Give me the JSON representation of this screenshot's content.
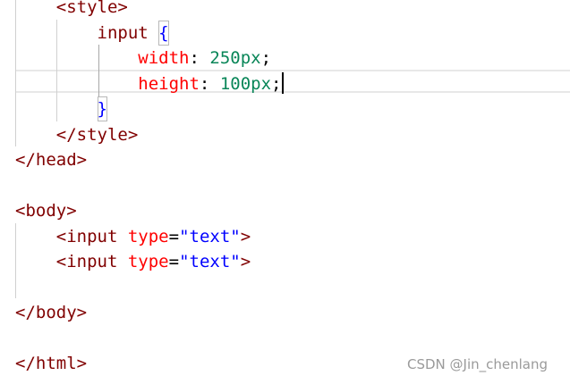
{
  "editor": {
    "lines": [
      {
        "indent": "    ",
        "parts": [
          {
            "t": "<style>",
            "c": "tag"
          }
        ]
      },
      {
        "indent": "        ",
        "parts": [
          {
            "t": "input",
            "c": "sel"
          },
          {
            "t": " ",
            "c": "punct"
          },
          {
            "t": "{",
            "c": "brace"
          }
        ]
      },
      {
        "indent": "            ",
        "parts": [
          {
            "t": "width",
            "c": "prop"
          },
          {
            "t": ": ",
            "c": "punct"
          },
          {
            "t": "250px",
            "c": "num"
          },
          {
            "t": ";",
            "c": "punct"
          }
        ]
      },
      {
        "indent": "            ",
        "parts": [
          {
            "t": "height",
            "c": "prop"
          },
          {
            "t": ": ",
            "c": "punct"
          },
          {
            "t": "100px",
            "c": "num"
          },
          {
            "t": ";",
            "c": "punct"
          }
        ]
      },
      {
        "indent": "        ",
        "parts": [
          {
            "t": "}",
            "c": "brace"
          }
        ]
      },
      {
        "indent": "    ",
        "parts": [
          {
            "t": "</style>",
            "c": "tag"
          }
        ]
      },
      {
        "indent": "",
        "parts": [
          {
            "t": "</head>",
            "c": "tag"
          }
        ]
      },
      {
        "indent": "",
        "parts": []
      },
      {
        "indent": "",
        "parts": [
          {
            "t": "<body>",
            "c": "tag"
          }
        ]
      },
      {
        "indent": "    ",
        "parts": [
          {
            "t": "<input",
            "c": "tag"
          },
          {
            "t": " ",
            "c": "punct"
          },
          {
            "t": "type",
            "c": "attr"
          },
          {
            "t": "=",
            "c": "punct"
          },
          {
            "t": "\"text\"",
            "c": "str"
          },
          {
            "t": ">",
            "c": "tag"
          }
        ]
      },
      {
        "indent": "    ",
        "parts": [
          {
            "t": "<input",
            "c": "tag"
          },
          {
            "t": " ",
            "c": "punct"
          },
          {
            "t": "type",
            "c": "attr"
          },
          {
            "t": "=",
            "c": "punct"
          },
          {
            "t": "\"text\"",
            "c": "str"
          },
          {
            "t": ">",
            "c": "tag"
          }
        ]
      },
      {
        "indent": "",
        "parts": []
      },
      {
        "indent": "",
        "parts": [
          {
            "t": "</body>",
            "c": "tag"
          }
        ]
      },
      {
        "indent": "",
        "parts": []
      },
      {
        "indent": "",
        "parts": [
          {
            "t": "</html>",
            "c": "tag"
          }
        ]
      }
    ]
  },
  "watermark": "CSDN @Jin_chenlang",
  "colors": {
    "tag": "#800000",
    "attribute": "#ff0000",
    "string": "#0000ff",
    "css_property": "#ff0000",
    "css_number": "#098658",
    "brace": "#0000ff"
  }
}
